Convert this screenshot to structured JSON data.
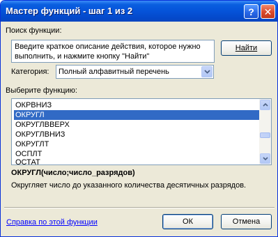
{
  "window": {
    "title": "Мастер функций - шаг 1 из 2",
    "help_button": "?",
    "close_button": "✕"
  },
  "search": {
    "label": "Поиск функции:",
    "description": "Введите краткое описание действия, которое нужно\nвыполнить, и нажмите кнопку \"Найти\"",
    "find_button": "Найти"
  },
  "category": {
    "label": "Категория:",
    "selected": "Полный алфавитный перечень"
  },
  "function_list": {
    "label": "Выберите функцию:",
    "items": [
      {
        "name": "ОКРВНИЗ",
        "selected": false
      },
      {
        "name": "ОКРУГЛ",
        "selected": true
      },
      {
        "name": "ОКРУГЛВВЕРХ",
        "selected": false
      },
      {
        "name": "ОКРУГЛВНИЗ",
        "selected": false
      },
      {
        "name": "ОКРУГЛТ",
        "selected": false
      },
      {
        "name": "ОСПЛТ",
        "selected": false
      },
      {
        "name": "ОСТАТ",
        "selected": false
      }
    ]
  },
  "function_info": {
    "signature": "ОКРУГЛ(число;число_разрядов)",
    "description": "Округляет число до указанного количества десятичных разрядов."
  },
  "footer": {
    "help_link": "Справка по этой функции",
    "ok_button": "ОК",
    "cancel_button": "Отмена"
  },
  "colors": {
    "title_bar": "#0553d9",
    "selection": "#316ac5",
    "dialog_bg": "#ece9d8",
    "link": "#0000ff"
  }
}
